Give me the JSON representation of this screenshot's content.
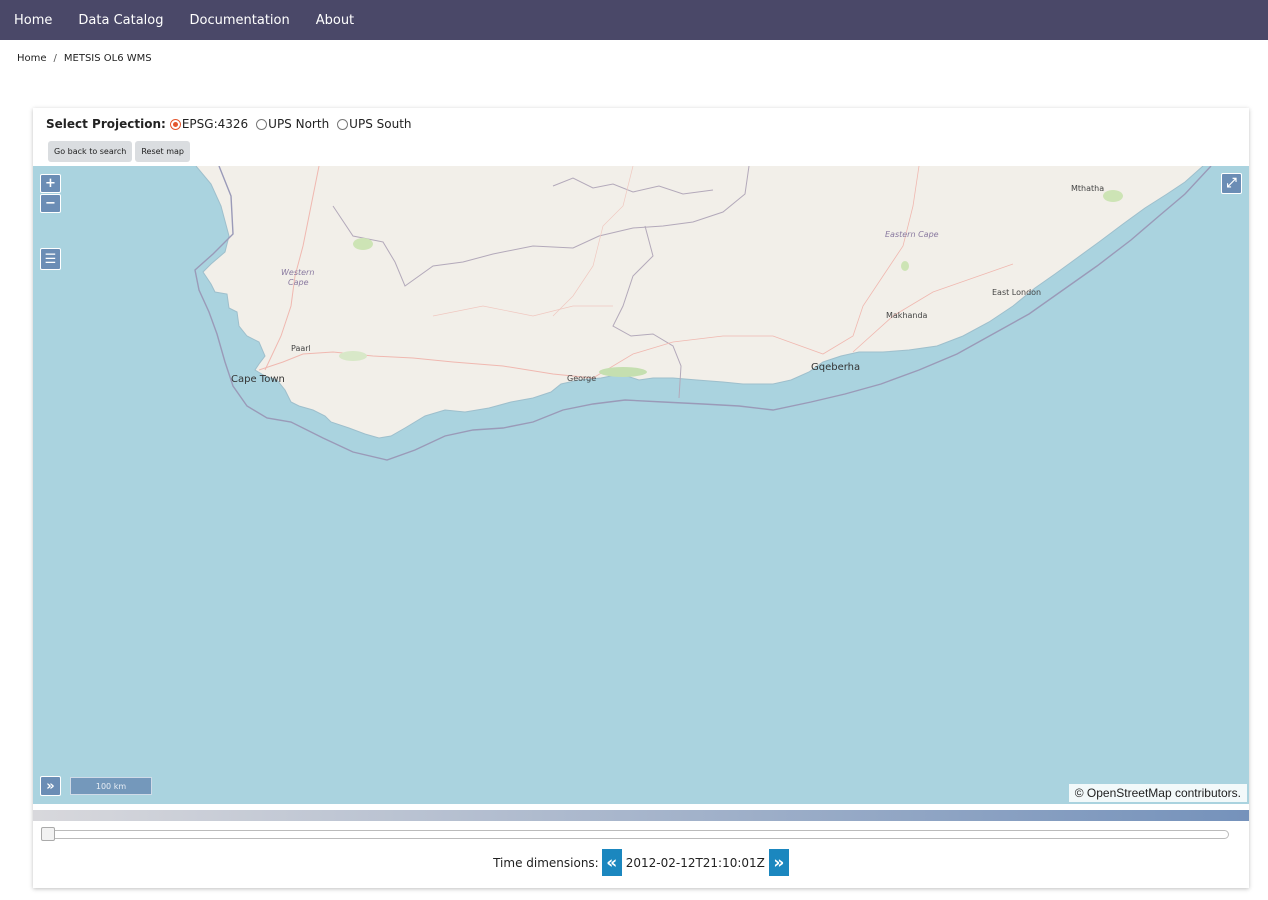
{
  "nav": {
    "items": [
      {
        "label": "Home"
      },
      {
        "label": "Data Catalog"
      },
      {
        "label": "Documentation"
      },
      {
        "label": "About"
      }
    ]
  },
  "breadcrumb": {
    "home": "Home",
    "separator": "/",
    "current": "METSIS OL6 WMS"
  },
  "projection": {
    "label": "Select Projection:",
    "options": [
      {
        "label": "EPSG:4326",
        "selected": true
      },
      {
        "label": "UPS North",
        "selected": false
      },
      {
        "label": "UPS South",
        "selected": false
      }
    ]
  },
  "buttons": {
    "back": "Go back to search",
    "reset": "Reset map"
  },
  "map": {
    "zoom_in": "+",
    "zoom_out": "−",
    "layers_icon": "☰",
    "fullscreen_icon": "⤢",
    "overview_icon": "»",
    "scale": "100 km",
    "attribution": "© OpenStreetMap contributors.",
    "places": {
      "mthatha": "Mthatha",
      "eastern_cape": "Eastern Cape",
      "western_cape_1": "Western",
      "western_cape_2": "Cape",
      "east_london": "East London",
      "makhanda": "Makhanda",
      "paarl": "Paarl",
      "cape_town": "Cape Town",
      "george": "George",
      "gqeberha": "Gqeberha"
    },
    "colors": {
      "water": "#aad3df",
      "land": "#f2efe9"
    }
  },
  "time": {
    "label": "Time dimensions:",
    "value": "2012-02-12T21:10:01Z",
    "prev_icon": "«",
    "next_icon": "»",
    "slider_position": 0
  }
}
